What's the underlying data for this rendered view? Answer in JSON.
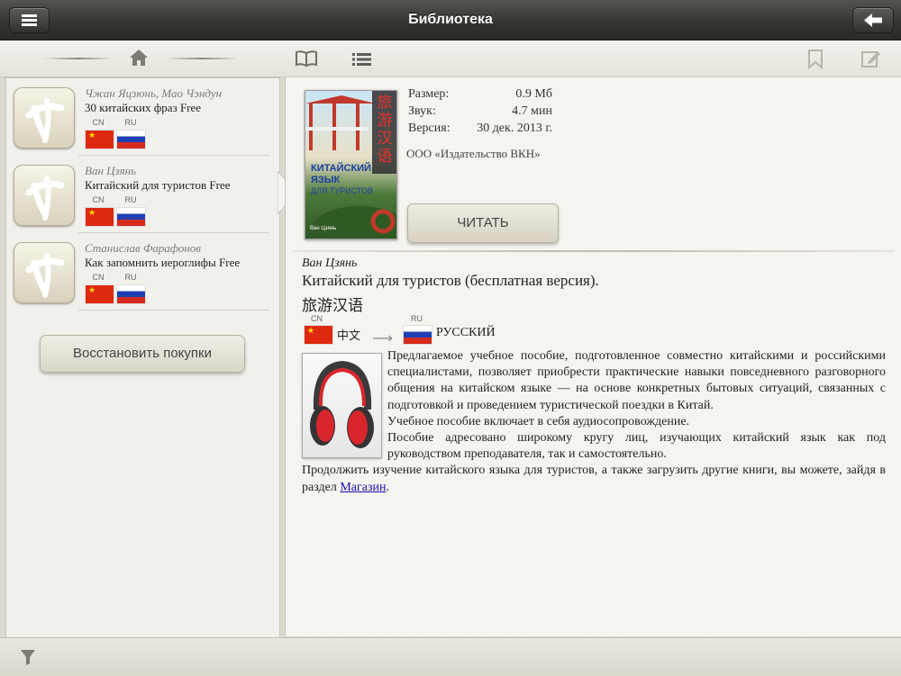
{
  "topbar": {
    "title": "Библиотека"
  },
  "library": {
    "books": [
      {
        "author": "Чжан Яцзюнь, Мао Чэндун",
        "title": "30 китайских фраз Free",
        "lang_from": "CN",
        "lang_to": "RU"
      },
      {
        "author": "Ван Цзянь",
        "title": "Китайский для туристов Free",
        "lang_from": "CN",
        "lang_to": "RU"
      },
      {
        "author": "Станислав Фарафонов",
        "title": "Как запомнить иероглифы Free",
        "lang_from": "CN",
        "lang_to": "RU"
      }
    ],
    "restore_label": "Восстановить покупки"
  },
  "detail": {
    "cover": {
      "chars": "旅游汉语",
      "line1": "КИТАЙСКИЙ",
      "line2": "ЯЗЫК",
      "line3": "ДЛЯ ТУРИСТОВ",
      "author": "Ван Цзянь"
    },
    "meta": {
      "size_label": "Размер:",
      "size_value": "0.9 Мб",
      "sound_label": "Звук:",
      "sound_value": "4.7 мин",
      "version_label": "Версия:",
      "version_value": "30 дек. 2013 г.",
      "publisher": "ООО «Издательство ВКН»"
    },
    "read_label": "ЧИТАТЬ",
    "author": "Ван Цзянь",
    "title": "Китайский для туристов (бесплатная версия).",
    "title_cn": "旅游汉语",
    "from_code": "CN",
    "from_name": "中文",
    "to_code": "RU",
    "to_name": "РУССКИЙ",
    "para1": "Предлагаемое учебное пособие, подготовленное совместно китайскими и российскими специалистами, позволяет приобрести практические навыки повседневного разговорного общения на китайском языке — на основе конкретных бытовых ситуаций, связанных с подготовкой и проведением туристической поездки в Китай.",
    "para2": "Учебное пособие включает в себя аудиосопровождение.",
    "para3": "Пособие адресовано широкому кругу лиц, изучающих китайский язык как под руководством преподавателя, так и самостоятельно.",
    "para4_text": "Продолжить изучение китайского языка для туристов, а также загрузить другие книги, вы можете, зайдя в раздел ",
    "para4_link": "Магазин",
    "para4_end": "."
  },
  "icons": {
    "menu": "menu-icon",
    "back": "back-arrow-icon",
    "home": "home-icon",
    "book": "open-book-icon",
    "list": "list-icon",
    "bookmark": "bookmark-icon",
    "note": "edit-note-icon",
    "filter": "filter-icon"
  },
  "colors": {
    "topbar": "#3a3a36",
    "paper": "#f5f4ef",
    "link": "#1a0dab"
  }
}
